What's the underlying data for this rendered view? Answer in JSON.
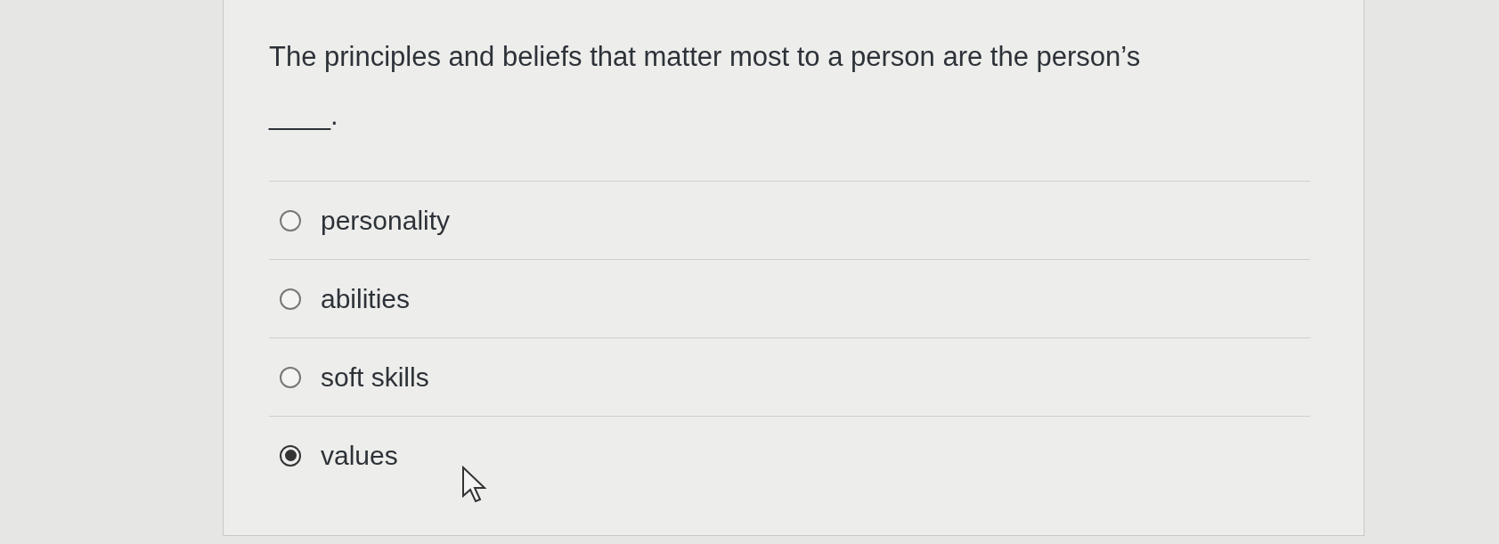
{
  "question": {
    "text": "The principles and beliefs that matter most to a person are the person’s ____."
  },
  "options": [
    {
      "label": "personality",
      "selected": false
    },
    {
      "label": "abilities",
      "selected": false
    },
    {
      "label": "soft skills",
      "selected": false
    },
    {
      "label": "values",
      "selected": true
    }
  ]
}
